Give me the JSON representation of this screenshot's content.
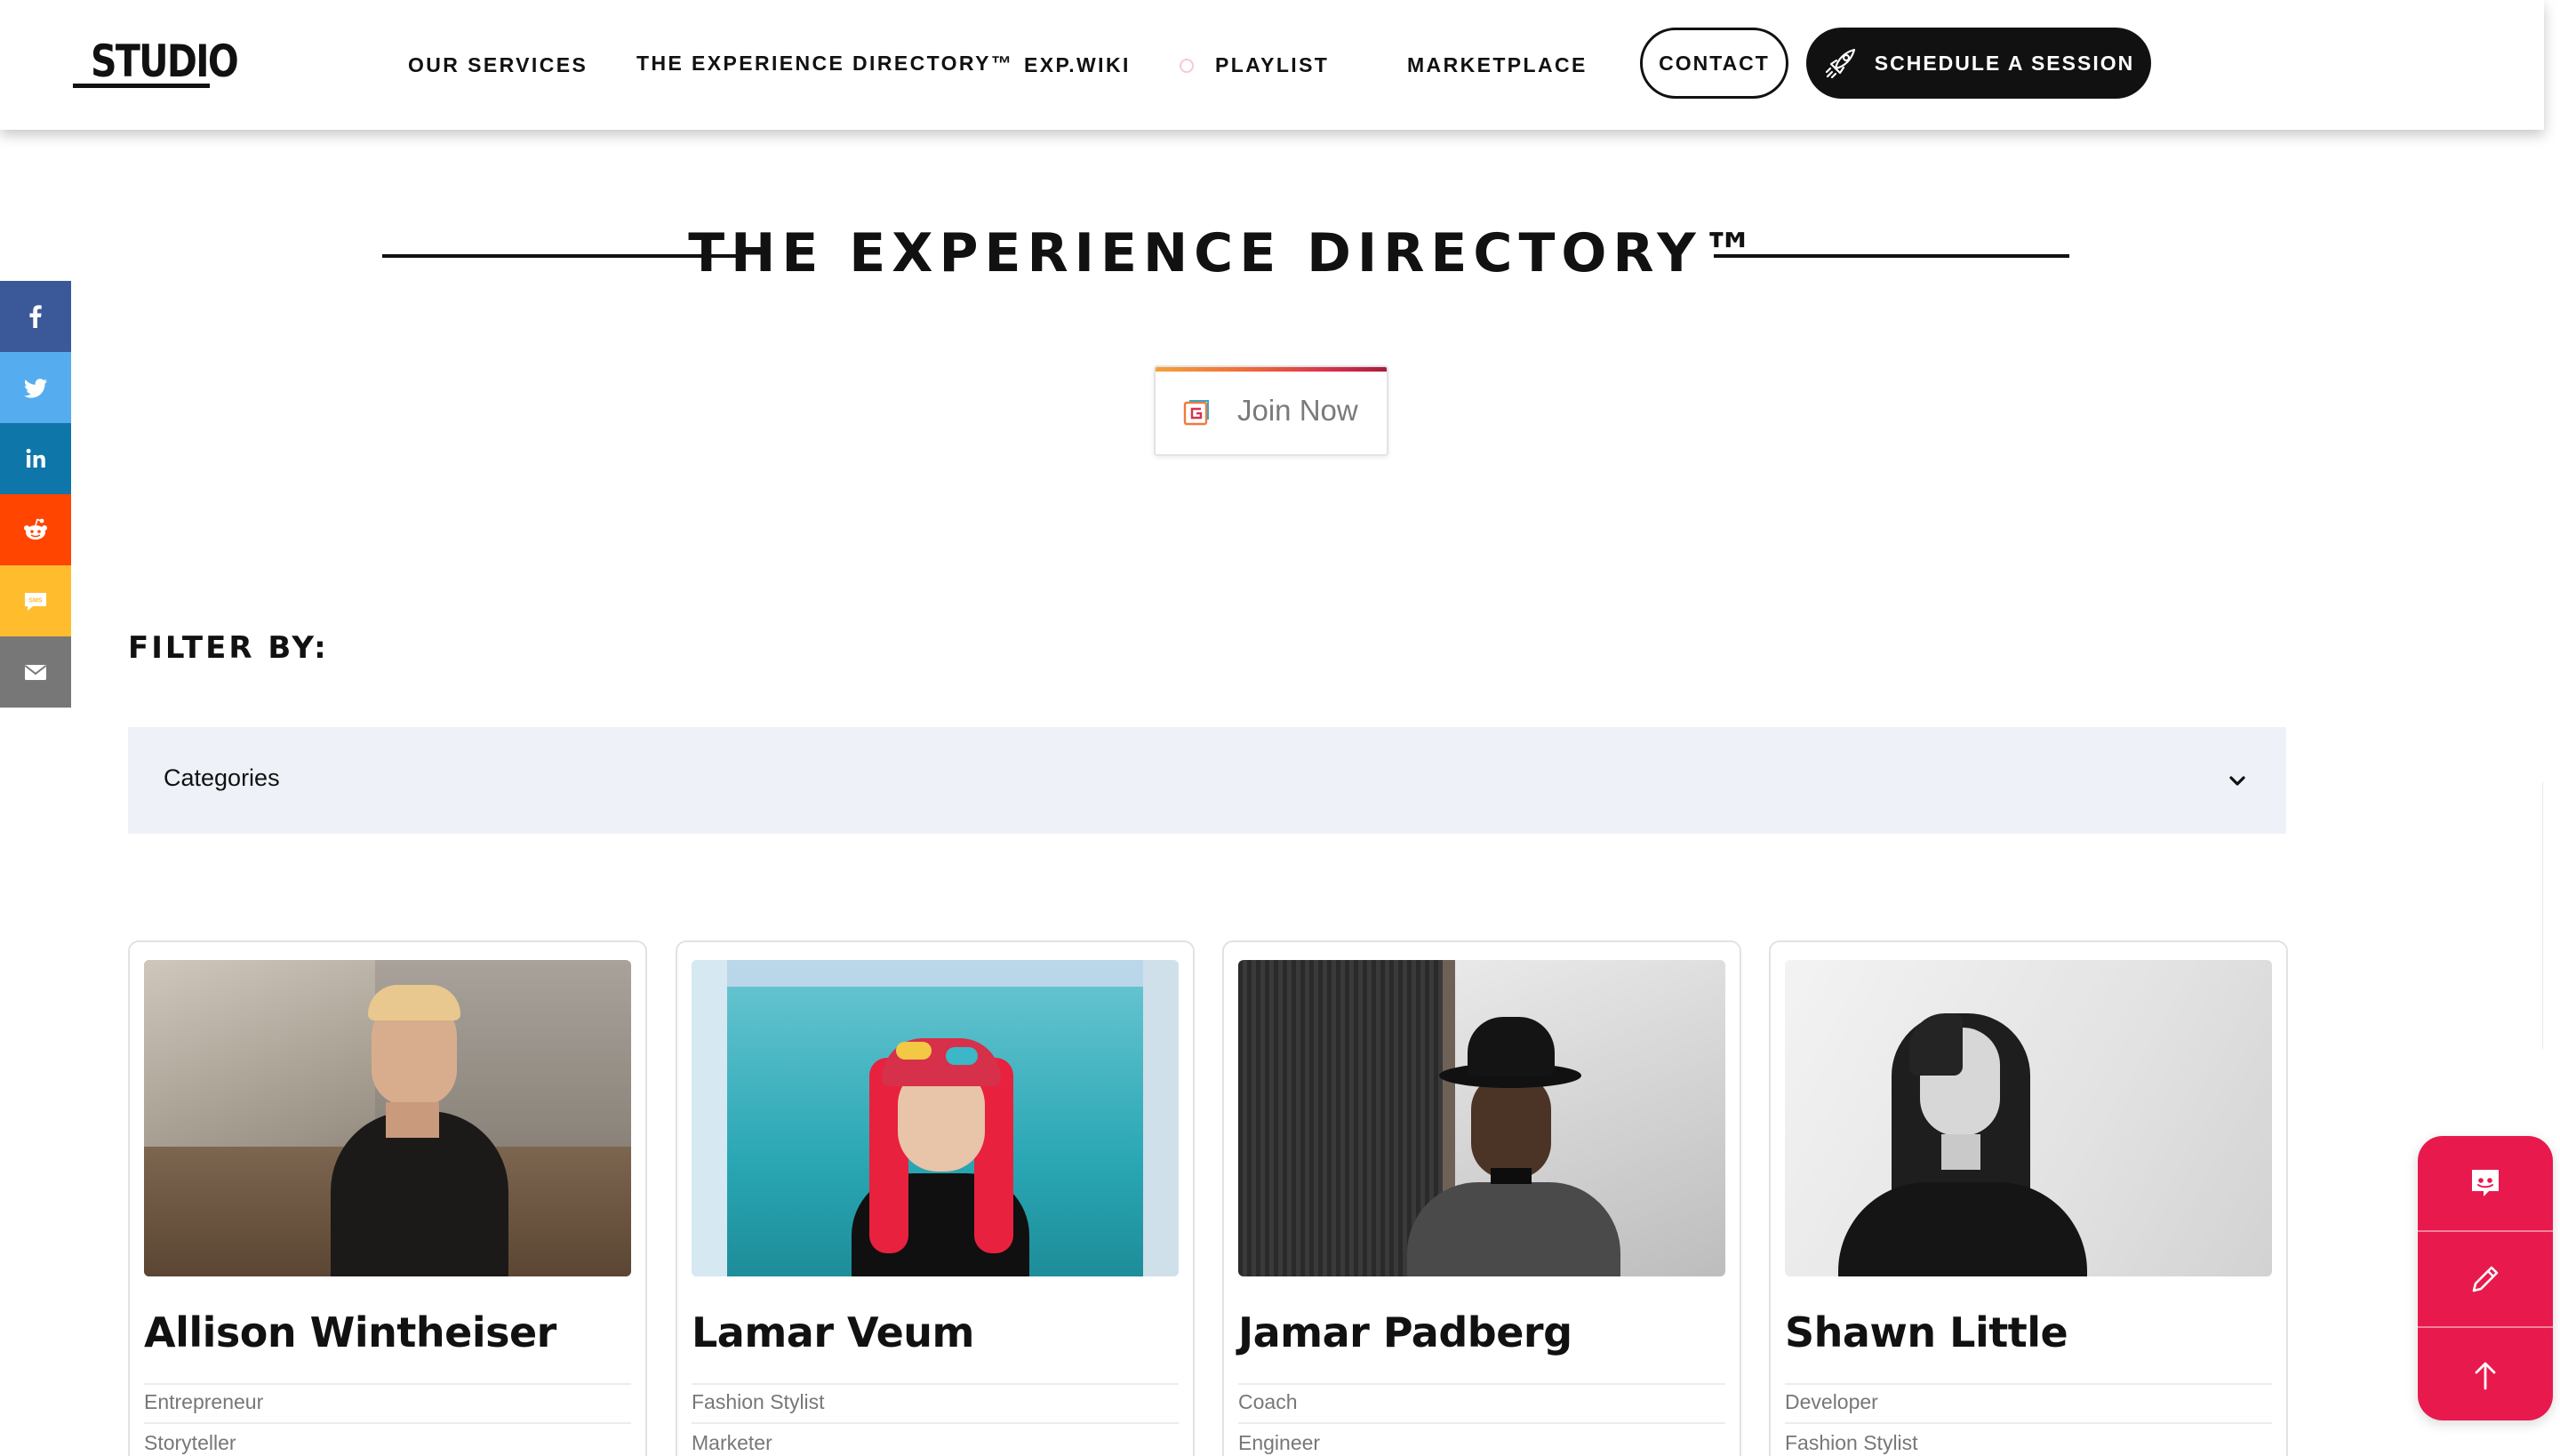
{
  "brand": {
    "logo": "STUDIO"
  },
  "nav": {
    "items": [
      "OUR SERVICES",
      "THE EXPERIENCE DIRECTORY™",
      "EXP.WIKI",
      "PLAYLIST",
      "MARKETPLACE"
    ],
    "contact_label": "CONTACT",
    "schedule_label": "SCHEDULE A SESSION"
  },
  "page": {
    "title": "THE EXPERIENCE DIRECTORY™",
    "join_label": "Join Now"
  },
  "share": {
    "items": [
      {
        "name": "facebook",
        "color": "#3b5998"
      },
      {
        "name": "twitter",
        "color": "#55acee"
      },
      {
        "name": "linkedin",
        "color": "#0e76a8"
      },
      {
        "name": "reddit",
        "color": "#ff4500"
      },
      {
        "name": "sms",
        "color": "#ffbd2e"
      },
      {
        "name": "email",
        "color": "#777777"
      }
    ]
  },
  "filter": {
    "label": "FILTER BY:",
    "select_value": "Categories"
  },
  "directory": {
    "people": [
      {
        "name": "Allison Wintheiser",
        "tags": [
          "Entrepreneur",
          "Storyteller"
        ]
      },
      {
        "name": "Lamar Veum",
        "tags": [
          "Fashion Stylist",
          "Marketer"
        ]
      },
      {
        "name": "Jamar Padberg",
        "tags": [
          "Coach",
          "Engineer"
        ]
      },
      {
        "name": "Shawn Little",
        "tags": [
          "Developer",
          "Fashion Stylist"
        ]
      }
    ]
  },
  "colors": {
    "accent": "#e8194d",
    "filter_bg": "#eef2f8",
    "text": "#111111"
  },
  "icons": {
    "schedule": "rocket-icon",
    "join": "g-logo-icon",
    "filter": "chevron-down-icon",
    "fab": [
      "discord-icon",
      "pencil-icon",
      "arrow-up-icon"
    ]
  }
}
